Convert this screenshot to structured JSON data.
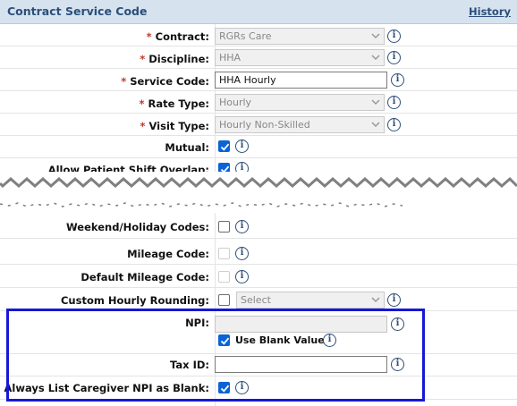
{
  "header": {
    "title": "Contract Service Code",
    "history_link": "History"
  },
  "fields": {
    "contract": {
      "label": "Contract:",
      "value": "RGRs Care"
    },
    "discipline": {
      "label": "Discipline:",
      "value": "HHA"
    },
    "service_code": {
      "label": "Service Code:",
      "value": "HHA Hourly"
    },
    "rate_type": {
      "label": "Rate Type:",
      "value": "Hourly"
    },
    "visit_type": {
      "label": "Visit Type:",
      "value": "Hourly Non-Skilled"
    },
    "mutual": {
      "label": "Mutual:",
      "checked": true
    },
    "allow_overlap": {
      "label": "Allow Patient Shift Overlap:",
      "checked": true
    },
    "weekend_codes": {
      "label": "Weekend/Holiday Codes:",
      "checked": false
    },
    "mileage_code": {
      "label": "Mileage Code:",
      "checked": false
    },
    "default_mileage_code": {
      "label": "Default Mileage Code:",
      "checked": false
    },
    "custom_rounding": {
      "label": "Custom Hourly Rounding:",
      "checked": false,
      "select_value": "Select"
    },
    "npi": {
      "label": "NPI:",
      "value": "",
      "use_blank_label": "Use Blank Value",
      "use_blank_checked": true
    },
    "tax_id": {
      "label": "Tax ID:",
      "value": ""
    },
    "always_list_blank": {
      "label": "Always List Caregiver NPI as Blank:",
      "checked": true
    }
  },
  "required_mark": "*",
  "info_glyph": "i",
  "colors": {
    "header_bg": "#d6e3ef",
    "link": "#2b4f7a",
    "required": "#c0392b",
    "checkbox": "#0a64d6",
    "highlight": "#1717d6"
  }
}
